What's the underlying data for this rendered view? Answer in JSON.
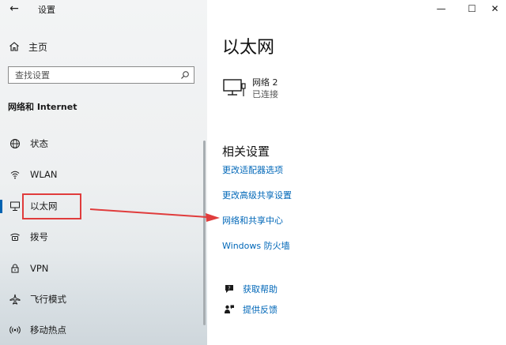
{
  "window": {
    "title": "设置",
    "back_glyph": "←",
    "minimize_glyph": "—",
    "maximize_glyph": "☐",
    "close_glyph": "✕"
  },
  "sidebar": {
    "home_label": "主页",
    "search_placeholder": "查找设置",
    "section_title": "网络和 Internet",
    "items": [
      {
        "label": "状态",
        "icon": "globe-status-icon"
      },
      {
        "label": "WLAN",
        "icon": "wifi-icon"
      },
      {
        "label": "以太网",
        "icon": "ethernet-icon",
        "active": true
      },
      {
        "label": "拨号",
        "icon": "dialup-icon"
      },
      {
        "label": "VPN",
        "icon": "vpn-icon"
      },
      {
        "label": "飞行模式",
        "icon": "airplane-icon"
      },
      {
        "label": "移动热点",
        "icon": "hotspot-icon"
      }
    ]
  },
  "main": {
    "page_title": "以太网",
    "network": {
      "name": "网络 2",
      "status": "已连接",
      "icon": "ethernet-monitor-icon"
    },
    "related_title": "相关设置",
    "links": [
      "更改适配器选项",
      "更改高级共享设置",
      "网络和共享中心",
      "Windows 防火墙"
    ],
    "help": [
      {
        "label": "获取帮助",
        "icon": "help-chat-icon"
      },
      {
        "label": "提供反馈",
        "icon": "feedback-icon"
      }
    ]
  },
  "colors": {
    "accent": "#0063b1",
    "link": "#0067b8",
    "annotation": "#e03c3c"
  }
}
